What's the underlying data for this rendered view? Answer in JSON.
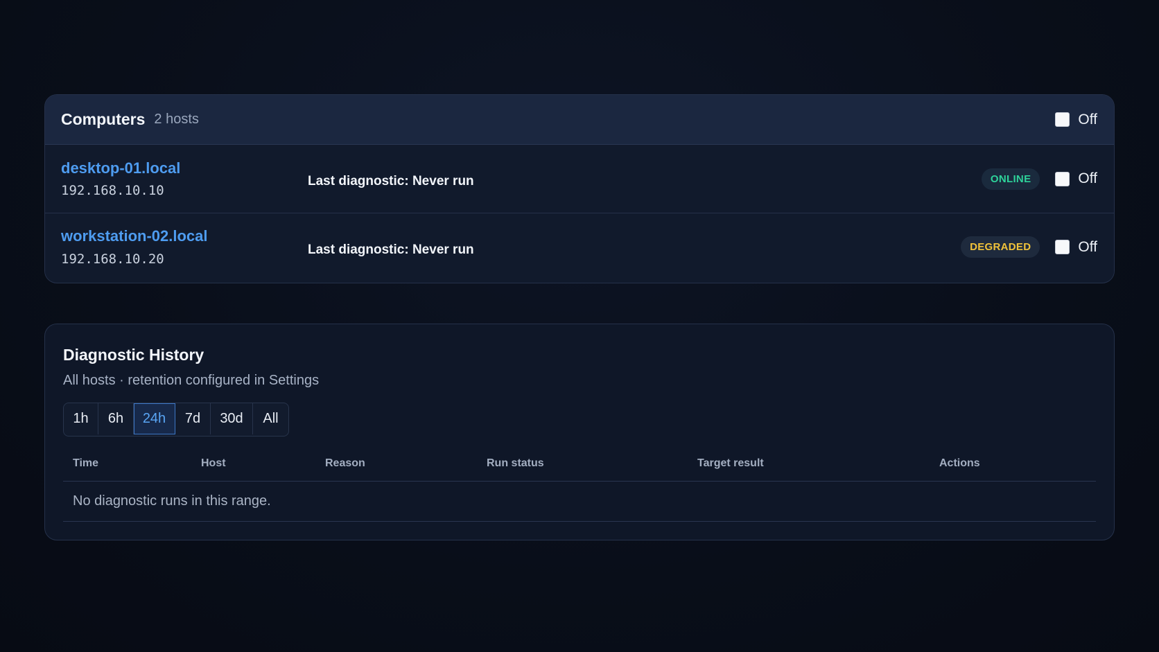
{
  "computers": {
    "title": "Computers",
    "count_label": "2 hosts",
    "toggle_label": "Off",
    "hosts": [
      {
        "name": "desktop-01.local",
        "ip": "192.168.10.10",
        "last_diagnostic": "Last diagnostic: Never run",
        "status": "ONLINE",
        "status_color": "#2ed39a",
        "toggle_label": "Off"
      },
      {
        "name": "workstation-02.local",
        "ip": "192.168.10.20",
        "last_diagnostic": "Last diagnostic: Never run",
        "status": "DEGRADED",
        "status_color": "#f0c23a",
        "toggle_label": "Off"
      }
    ]
  },
  "history": {
    "title": "Diagnostic History",
    "subtitle": "All hosts · retention configured in Settings",
    "ranges": [
      "1h",
      "6h",
      "24h",
      "7d",
      "30d",
      "All"
    ],
    "active_range": "24h",
    "columns": [
      "Time",
      "Host",
      "Reason",
      "Run status",
      "Target result",
      "Actions"
    ],
    "empty_message": "No diagnostic runs in this range."
  },
  "colors": {
    "accent": "#4e9cf0",
    "background": "#090e19"
  }
}
